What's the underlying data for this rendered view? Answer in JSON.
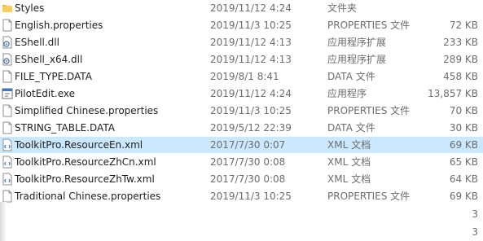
{
  "files": [
    {
      "icon": "folder-icon",
      "name": "Styles",
      "date": "2019/11/12 4:24",
      "type": "文件夹",
      "size": ""
    },
    {
      "icon": "document-icon",
      "name": "English.properties",
      "date": "2019/11/3 10:25",
      "type": "PROPERTIES 文件",
      "size": "72 KB"
    },
    {
      "icon": "dll-icon",
      "name": "EShell.dll",
      "date": "2019/11/12 4:13",
      "type": "应用程序扩展",
      "size": "233 KB"
    },
    {
      "icon": "dll-icon",
      "name": "EShell_x64.dll",
      "date": "2019/11/12 4:13",
      "type": "应用程序扩展",
      "size": "289 KB"
    },
    {
      "icon": "document-icon",
      "name": "FILE_TYPE.DATA",
      "date": "2019/8/1 8:41",
      "type": "DATA 文件",
      "size": "458 KB"
    },
    {
      "icon": "exe-icon",
      "name": "PilotEdit.exe",
      "date": "2019/11/12 4:24",
      "type": "应用程序",
      "size": "13,857 KB"
    },
    {
      "icon": "document-icon",
      "name": "Simplified Chinese.properties",
      "date": "2019/11/3 10:25",
      "type": "PROPERTIES 文件",
      "size": "70 KB"
    },
    {
      "icon": "document-icon",
      "name": "STRING_TABLE.DATA",
      "date": "2019/5/12 22:39",
      "type": "DATA 文件",
      "size": "30 KB"
    },
    {
      "icon": "xml-icon",
      "name": "ToolkitPro.ResourceEn.xml",
      "date": "2017/7/30 0:07",
      "type": "XML 文档",
      "size": "69 KB"
    },
    {
      "icon": "xml-icon",
      "name": "ToolkitPro.ResourceZhCn.xml",
      "date": "2017/7/30 0:08",
      "type": "XML 文档",
      "size": "65 KB"
    },
    {
      "icon": "xml-icon",
      "name": "ToolkitPro.ResourceZhTw.xml",
      "date": "2017/7/30 0:08",
      "type": "XML 文档",
      "size": "64 KB"
    },
    {
      "icon": "document-icon",
      "name": "Traditional Chinese.properties",
      "date": "2019/11/3 10:25",
      "type": "PROPERTIES 文件",
      "size": "69 KB"
    }
  ],
  "selected_index": 8,
  "partial_sizes": [
    "3",
    "3"
  ],
  "colors": {
    "selection": "#cce8ff",
    "folder": "#e8b830",
    "text": "#1e1e1e",
    "meta_text": "#6d6d6d"
  }
}
